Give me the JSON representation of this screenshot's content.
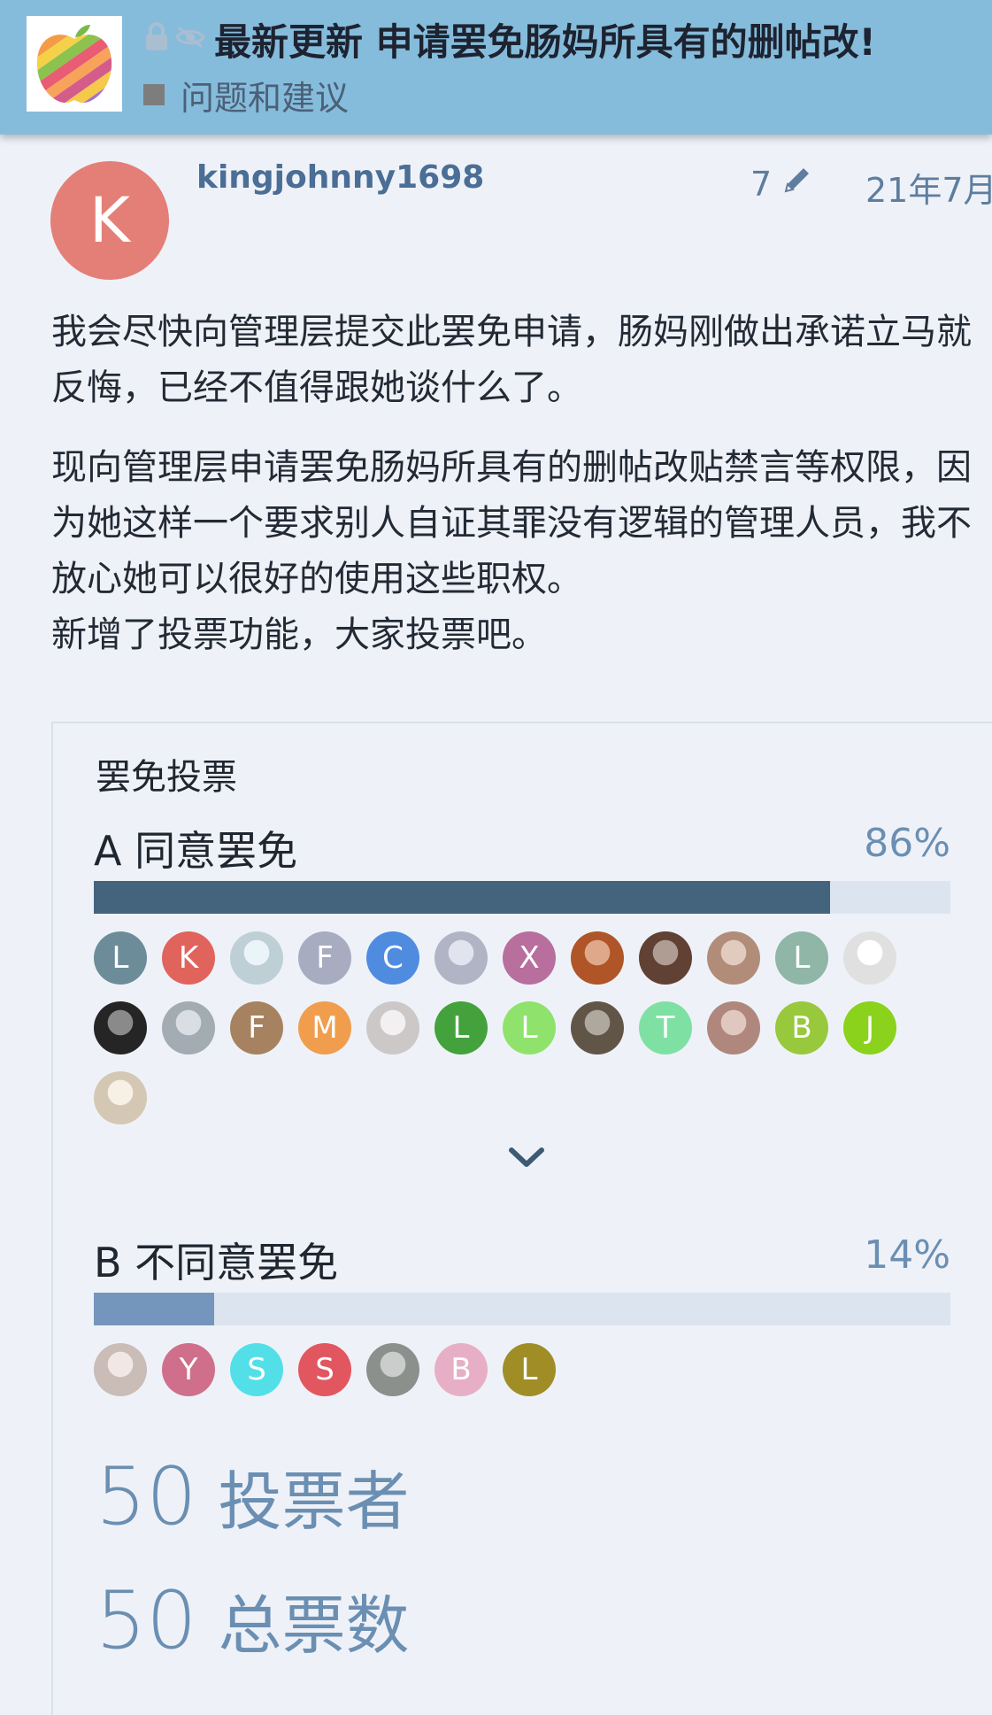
{
  "header": {
    "title": "最新更新 申请罢免肠妈所具有的删帖改!",
    "category": "问题和建议",
    "logo_icon": "apple-stripes-logo",
    "status_icons": [
      "lock-icon",
      "unlisted-icon"
    ]
  },
  "post": {
    "author_initial": "K",
    "author_avatar_color": "#e47f77",
    "username": "kingjohnny1698",
    "edit_count": "7",
    "date": "21年7月",
    "paragraphs": [
      "我会尽快向管理层提交此罢免申请，肠妈刚做出承诺立马就反悔，已经不值得跟她谈什么了。",
      "现向管理层申请罢免肠妈所具有的删帖改贴禁言等权限，因为她这样一个要求别人自证其罪没有逻辑的管理人员，我不放心她可以很好的使用这些职权。\n新增了投票功能，大家投票吧。"
    ]
  },
  "poll": {
    "title": "罢免投票",
    "options": [
      {
        "label": "A 同意罢免",
        "percent_text": "86%",
        "percent": 86,
        "bar_color": "#44647d",
        "voters": [
          {
            "initial": "L",
            "color": "#6d8c9a"
          },
          {
            "initial": "K",
            "color": "#e0645c"
          },
          {
            "initial": "",
            "color": "#d8ecf4",
            "icon": "cartoon-glasses-avatar"
          },
          {
            "initial": "F",
            "color": "#a7acc1"
          },
          {
            "initial": "C",
            "color": "#4f8ce0"
          },
          {
            "initial": "",
            "color": "#c9cde0",
            "icon": "white-cat-avatar"
          },
          {
            "initial": "X",
            "color": "#b86f9e"
          },
          {
            "initial": "",
            "color": "#c7612c",
            "icon": "orange-car-avatar"
          },
          {
            "initial": "",
            "color": "#6d4a3a",
            "icon": "brown-photo-avatar"
          },
          {
            "initial": "",
            "color": "#c9a08a",
            "icon": "portrait-avatar"
          },
          {
            "initial": "L",
            "color": "#8fb6a6"
          },
          {
            "initial": "",
            "color": "#ffffff",
            "icon": "red-hair-avatar"
          },
          {
            "initial": "",
            "color": "#2a2a2a",
            "icon": "flower-bw-avatar"
          },
          {
            "initial": "",
            "color": "#b9c3cc",
            "icon": "room-photo-avatar"
          },
          {
            "initial": "F",
            "color": "#a78260"
          },
          {
            "initial": "M",
            "color": "#f09e4e"
          },
          {
            "initial": "",
            "color": "#e8e4e4",
            "icon": "girl-portrait-avatar"
          },
          {
            "initial": "L",
            "color": "#44a23c"
          },
          {
            "initial": "L",
            "color": "#8fe36c"
          },
          {
            "initial": "",
            "color": "#6e6151",
            "icon": "cat-photo-avatar"
          },
          {
            "initial": "T",
            "color": "#7fe0a4"
          },
          {
            "initial": "",
            "color": "#c79a8e",
            "icon": "hands-photo-avatar"
          },
          {
            "initial": "B",
            "color": "#98c93c"
          },
          {
            "initial": "J",
            "color": "#8ad21c"
          },
          {
            "initial": "",
            "color": "#f1e3cd",
            "icon": "anime-girl-avatar"
          }
        ]
      },
      {
        "label": "B 不同意罢免",
        "percent_text": "14%",
        "percent": 14,
        "bar_color": "#7596bc",
        "voters": [
          {
            "initial": "",
            "color": "#e6d6cf",
            "icon": "cosmetics-photo-avatar"
          },
          {
            "initial": "Y",
            "color": "#cf6f8b"
          },
          {
            "initial": "S",
            "color": "#53dfe8"
          },
          {
            "initial": "S",
            "color": "#e25660"
          },
          {
            "initial": "",
            "color": "#9ea4a0",
            "icon": "snow-people-avatar"
          },
          {
            "initial": "B",
            "color": "#e7afc5"
          },
          {
            "initial": "L",
            "color": "#a08d26"
          }
        ]
      }
    ],
    "expand_icon": "chevron-down-icon",
    "voters_count": "50",
    "voters_label": "投票者",
    "total_votes": "50",
    "total_votes_label": "总票数"
  }
}
